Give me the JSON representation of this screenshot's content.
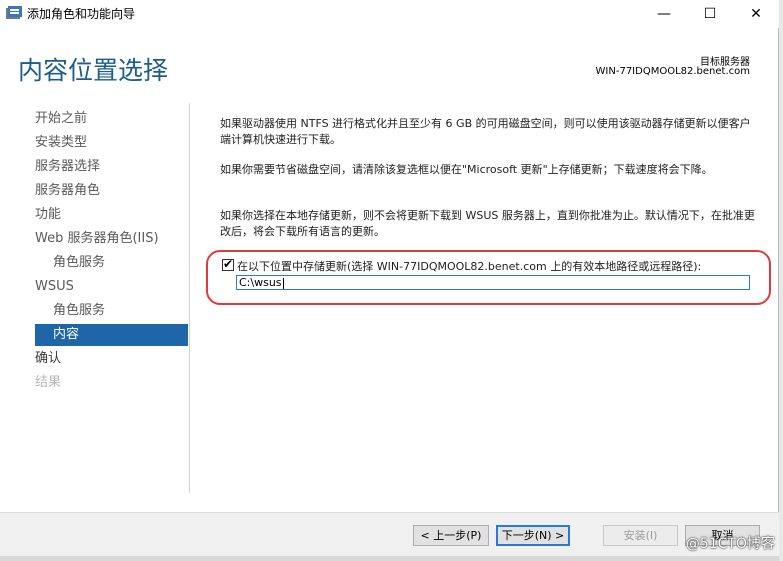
{
  "window": {
    "title": "添加角色和功能向导",
    "minimize": "—",
    "maximize": "☐",
    "close": "✕"
  },
  "header": {
    "page_title": "内容位置选择",
    "target_label": "目标服务器",
    "target_name": "WIN-77IDQMOOL82.benet.com"
  },
  "nav": {
    "items": [
      {
        "label": "开始之前"
      },
      {
        "label": "安装类型"
      },
      {
        "label": "服务器选择"
      },
      {
        "label": "服务器角色"
      },
      {
        "label": "功能"
      },
      {
        "label": "Web 服务器角色(IIS)"
      },
      {
        "label": "角色服务"
      },
      {
        "label": "WSUS"
      },
      {
        "label": "角色服务"
      },
      {
        "label": "内容"
      },
      {
        "label": "确认"
      },
      {
        "label": "结果"
      }
    ]
  },
  "content": {
    "para1": "如果驱动器使用 NTFS 进行格式化并且至少有 6 GB 的可用磁盘空间，则可以使用该驱动器存储更新以便客户端计算机快速进行下载。",
    "para2": "如果你需要节省磁盘空间，请清除该复选框以便在\"Microsoft 更新\"上存储更新；下载速度将会下降。",
    "para3": "如果你选择在本地存储更新，则不会将更新下载到 WSUS 服务器上，直到你批准为止。默认情况下，在批准更改后，将会下载所有语言的更新。",
    "checkbox_label": "在以下位置中存储更新(选择 WIN-77IDQMOOL82.benet.com 上的有效本地路径或远程路径):",
    "checkbox_checked": true,
    "path_value": "C:\\wsus"
  },
  "footer": {
    "prev": "< 上一步(P)",
    "next": "下一步(N) >",
    "install": "安装(I)",
    "cancel": "取消"
  },
  "watermark": "@51CTO博客",
  "colors": {
    "title_blue": "#1b5e8b",
    "nav_active": "#1f66a8",
    "highlight_red": "#e23a3a"
  }
}
